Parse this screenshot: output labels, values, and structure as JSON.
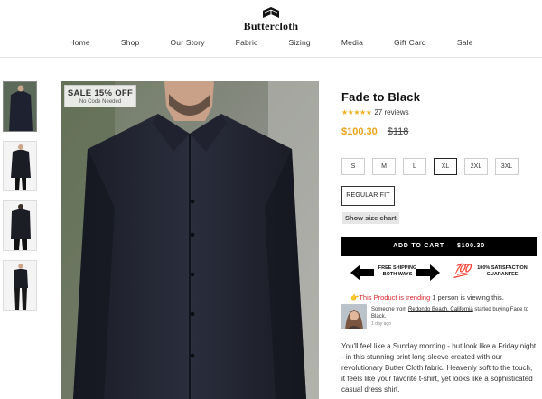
{
  "brand": {
    "name": "Buttercloth"
  },
  "nav": {
    "items": [
      "Home",
      "Shop",
      "Our Story",
      "Fabric",
      "Sizing",
      "Media",
      "Gift Card",
      "Sale"
    ]
  },
  "badge": {
    "title": "SALE 15% OFF",
    "subtitle": "No Code Needed"
  },
  "product": {
    "title": "Fade to Black",
    "stars": "★★★★★",
    "reviews": "27 reviews",
    "price_sale": "$100.30",
    "price_original": "$118"
  },
  "sizes": {
    "options": [
      "S",
      "M",
      "L",
      "XL",
      "2XL",
      "3XL"
    ],
    "selected": "XL"
  },
  "fit": {
    "label": "REGULAR FIT"
  },
  "size_chart": {
    "label": "Show size chart"
  },
  "cart": {
    "label": "ADD TO CART",
    "price": "$100.30"
  },
  "perks": {
    "shipping": "FREE SHIPPING BOTH WAYS",
    "hundred": "💯",
    "satisfaction": "100% SATISFACTION GUARANTEE"
  },
  "trending": {
    "icon": "👉",
    "prefix": "This Product is trending",
    "suffix": " 1 person is viewing this."
  },
  "social_proof": {
    "lead": "Someone from ",
    "location": "Redondo Beach, California",
    "tail": " started buying Fade to Black.",
    "time": "1 day ago"
  },
  "description": "You'll feel like a Sunday morning - but look like a Friday night - in this stunning print long sleeve created with our revolutionary Butter Cloth fabric. Heavenly soft to the touch, it feels like your favorite t-shirt, yet looks like a sophisticated casual dress shirt.",
  "colors": {
    "accent": "#e8a317",
    "trend_red": "#d7262c",
    "cart_bg": "#000000"
  }
}
